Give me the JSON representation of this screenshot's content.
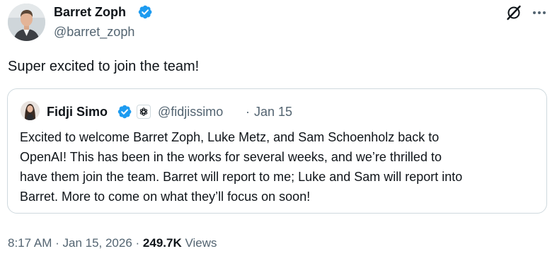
{
  "author": {
    "name": "Barret Zoph",
    "handle": "@barret_zoph"
  },
  "tweet": {
    "text": "Super excited to join the team!"
  },
  "quoted_tweet": {
    "author_name": "Fidji Simo",
    "handle": "@fidjissimo",
    "separator": "·",
    "date": "Jan 15",
    "lines": [
      "Excited to welcome Barret Zoph, Luke Metz, and Sam Schoenholz back to",
      "OpenAI! This has been in the works for several weeks, and we’re thrilled to",
      "have them join the team. Barret will report to me; Luke and Sam will report into",
      "Barret. More to come on what they’ll focus on soon!"
    ]
  },
  "meta": {
    "time": "8:17 AM",
    "sep1": " · ",
    "date": "Jan 15, 2026",
    "sep2": " · ",
    "views_count": "249.7K",
    "views_label": " Views"
  },
  "icons": {
    "verified": "verified-badge-icon",
    "affiliate": "openai-logo-icon",
    "grok": "grok-icon",
    "more": "more-dots-icon"
  },
  "colors": {
    "text_primary": "#0f1419",
    "text_secondary": "#536471",
    "verified_blue": "#1d9bf0",
    "border": "#cfd9de"
  }
}
